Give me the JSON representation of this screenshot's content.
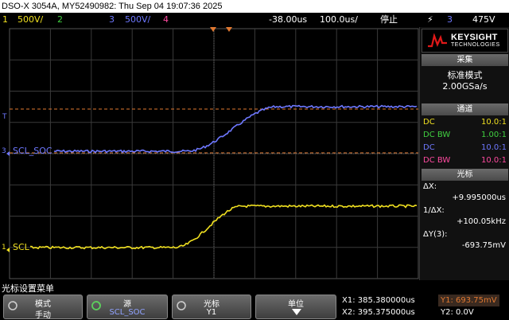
{
  "title_bar": "DSO-X 3054A, MY52490982: Thu Sep 04 19:07:36 2025",
  "status": {
    "ch1_num": "1",
    "ch1_scale": "500V/",
    "ch2_num": "2",
    "ch3_num": "3",
    "ch3_scale": "500V/",
    "ch4_num": "4",
    "time_delay": "-38.00us",
    "time_scale": "100.0us/",
    "run_state": "停止",
    "trigger_level": "475V"
  },
  "screen": {
    "ch3_label": "SCL_SOC",
    "ch3_marker": "3",
    "ch1_label": "SCL",
    "ch1_marker": "1",
    "cursor_t_marker": "T",
    "colors": {
      "ch1": "#f0e020",
      "ch3": "#6e78ff",
      "cursor": "#e07830",
      "grid": "#3a3a3a"
    }
  },
  "brand": {
    "name": "KEYSIGHT",
    "sub": "TECHNOLOGIES"
  },
  "acquisition": {
    "header": "采集",
    "mode": "标准模式",
    "rate": "2.00GSa/s"
  },
  "channels": {
    "header": "通道",
    "rows": [
      {
        "coupling": "DC",
        "probe": "10.0:1"
      },
      {
        "coupling": "DC BW",
        "probe": "1.00:1"
      },
      {
        "coupling": "DC",
        "probe": "10.0:1"
      },
      {
        "coupling": "DC BW",
        "probe": "10.0:1"
      }
    ]
  },
  "cursors": {
    "header": "光标",
    "dx_label": "ΔX:",
    "dx_value": "+9.995000us",
    "inv_dx_label": "1/ΔX:",
    "inv_dx_value": "+100.05kHz",
    "dy_label": "ΔY(3):",
    "dy_value": "-693.75mV"
  },
  "menu": {
    "title": "光标设置菜单",
    "keys": [
      {
        "top": "模式",
        "bottom": "手动"
      },
      {
        "top": "源",
        "bottom": "SCL_SOC"
      },
      {
        "top": "光标",
        "bottom": "Y1"
      },
      {
        "top": "单位",
        "bottom": ""
      }
    ]
  },
  "readout": {
    "x1": "X1: 385.380000us",
    "x2": "X2: 395.375000us",
    "y1": "Y1: 693.75mV",
    "y2": "Y2: 0.0V"
  }
}
